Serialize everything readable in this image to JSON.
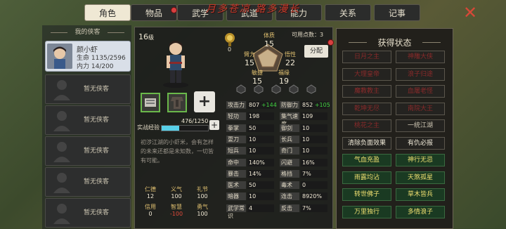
{
  "tabs": [
    {
      "label": "角色"
    },
    {
      "label": "物品"
    },
    {
      "label": "武学"
    },
    {
      "label": "武道"
    },
    {
      "label": "能力"
    },
    {
      "label": "关系"
    },
    {
      "label": "记事"
    }
  ],
  "banner": "月多苍凉 路多漫长",
  "close_icon": "close-icon",
  "roster": {
    "title": "我的侠客",
    "hero": {
      "name": "颜小虾",
      "hp": "生命 1135/2596",
      "mp": "内力 14/200"
    },
    "empty_label": "暂无侠客"
  },
  "character": {
    "level": "16",
    "level_unit": "级",
    "medal_value": "0",
    "points_label": "可用点数：3",
    "allocate_button": "分配",
    "attributes": [
      {
        "name": "体质",
        "value": "15"
      },
      {
        "name": "臂力",
        "value": "15"
      },
      {
        "name": "悟性",
        "value": "22"
      },
      {
        "name": "敏捷",
        "value": "15"
      },
      {
        "name": "福缘",
        "value": "19"
      }
    ],
    "exp_label": "实战经验",
    "exp_value": "476/1250",
    "exp_progress": 0.381,
    "description": "初涉江湖的小虾米，会有怎样的未来还都是未知数，一切皆有可能。",
    "personality": [
      {
        "name": "仁德",
        "value": "12"
      },
      {
        "name": "义气",
        "value": "100"
      },
      {
        "name": "礼节",
        "value": "100"
      },
      {
        "name": "信用",
        "value": "0"
      },
      {
        "name": "智慧",
        "value": "-100"
      },
      {
        "name": "勇气",
        "value": "100"
      }
    ]
  },
  "stats_left": [
    {
      "k": "攻击力",
      "v": "807",
      "up": "+144"
    },
    {
      "k": "轻功",
      "v": "198"
    },
    {
      "k": "拳掌",
      "v": "50"
    },
    {
      "k": "耍刀",
      "v": "10"
    },
    {
      "k": "短兵",
      "v": "10"
    },
    {
      "k": "命中",
      "v": "140%"
    },
    {
      "k": "暴击",
      "v": "14%"
    },
    {
      "k": "医术",
      "v": "50"
    },
    {
      "k": "暗器",
      "v": "10"
    },
    {
      "k": "武学常识",
      "v": "4"
    }
  ],
  "stats_right": [
    {
      "k": "防御力",
      "v": "852",
      "up": "+105"
    },
    {
      "k": "集气速度",
      "v": "109"
    },
    {
      "k": "御剑",
      "v": "10"
    },
    {
      "k": "长兵",
      "v": "10"
    },
    {
      "k": "奇门",
      "v": "10"
    },
    {
      "k": "闪避",
      "v": "16%"
    },
    {
      "k": "格挡",
      "v": "7%"
    },
    {
      "k": "毒术",
      "v": "0"
    },
    {
      "k": "连击",
      "v": "8920%"
    },
    {
      "k": "反击",
      "v": "7%"
    }
  ],
  "status_panel": {
    "title": "获得状态",
    "items": [
      {
        "label": "日月之主",
        "state": "off"
      },
      {
        "label": "神雕大侠",
        "state": "off"
      },
      {
        "label": "大理皇帝",
        "state": "off"
      },
      {
        "label": "浪子归途",
        "state": "off"
      },
      {
        "label": "魔教教主",
        "state": "off"
      },
      {
        "label": "血屠老怪",
        "state": "off"
      },
      {
        "label": "乾坤无尽",
        "state": "off"
      },
      {
        "label": "南院大王",
        "state": "off"
      },
      {
        "label": "桃花之主",
        "state": "off"
      },
      {
        "label": "一统江湖",
        "state": "neutral"
      },
      {
        "label": "清除负面效果",
        "state": "white"
      },
      {
        "label": "有仇必报",
        "state": "white"
      },
      {
        "label": "气血充盈",
        "state": "on"
      },
      {
        "label": "神行无忌",
        "state": "on"
      },
      {
        "label": "雨露均沾",
        "state": "on"
      },
      {
        "label": "天煞孤星",
        "state": "on"
      },
      {
        "label": "转世佛子",
        "state": "on"
      },
      {
        "label": "草木皆兵",
        "state": "on"
      },
      {
        "label": "万里独行",
        "state": "on"
      },
      {
        "label": "多情浪子",
        "state": "on"
      }
    ]
  },
  "colors": {
    "active_green": "#f0e070",
    "locked_red": "#8a2a2a",
    "exp_bar": "#58d0e8"
  }
}
